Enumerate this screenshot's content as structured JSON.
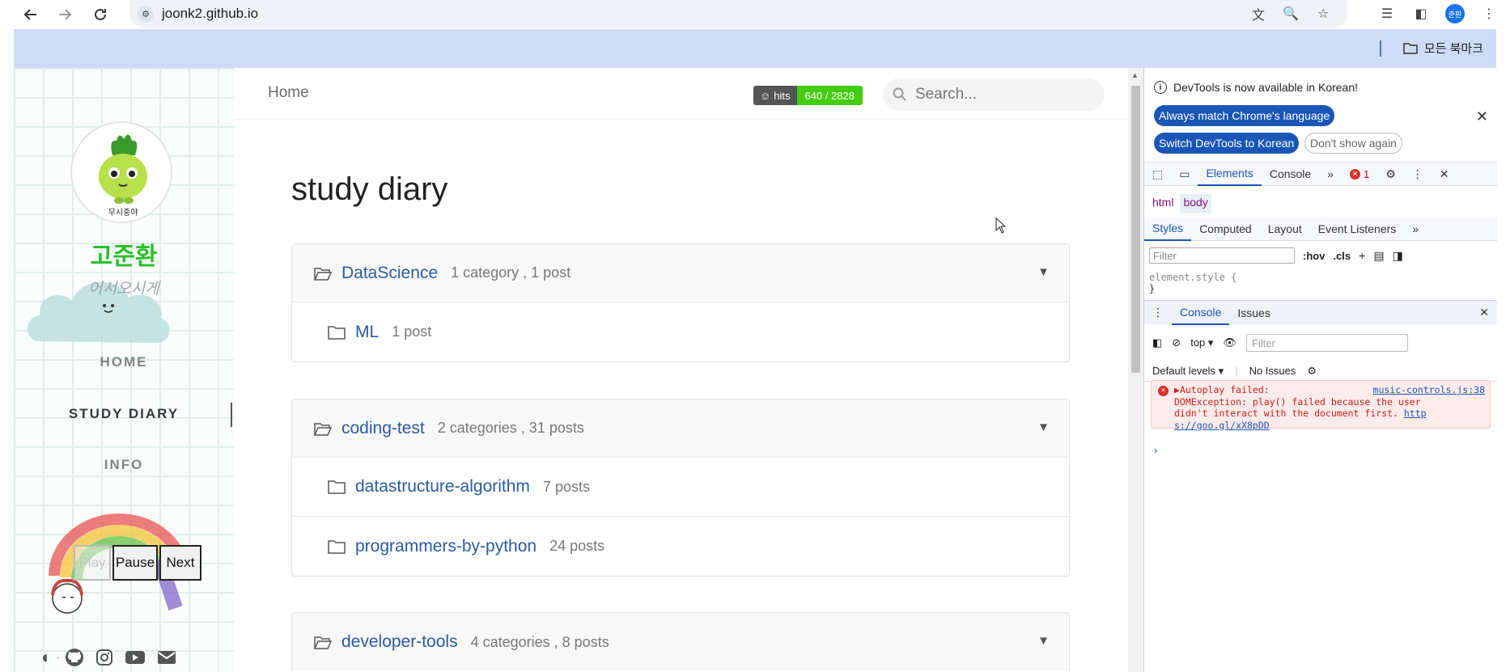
{
  "browser": {
    "url": "joonk2.github.io",
    "profile_initials": "준환",
    "bookmarks_all": "모든 북마크"
  },
  "sidebar": {
    "avatar_caption": "무시중야",
    "title": "고준환",
    "subtitle": "어서오시게",
    "nav": [
      {
        "label": "HOME"
      },
      {
        "label": "STUDY DIARY"
      },
      {
        "label": "INFO"
      }
    ],
    "music": {
      "play": "Play",
      "pause": "Pause",
      "next": "Next"
    },
    "accent_color": "#2bc02b"
  },
  "main": {
    "breadcrumb": "Home",
    "hits": {
      "label": "hits",
      "value": "640 / 2828"
    },
    "search_placeholder": "Search...",
    "page_title": "study diary",
    "categories": [
      {
        "name": "DataScience",
        "meta": "1 category , 1 post",
        "children": [
          {
            "name": "ML",
            "meta": "1 post"
          }
        ]
      },
      {
        "name": "coding-test",
        "meta": "2 categories , 31 posts",
        "children": [
          {
            "name": "datastructure-algorithm",
            "meta": "7 posts"
          },
          {
            "name": "programmers-by-python",
            "meta": "24 posts"
          }
        ]
      },
      {
        "name": "developer-tools",
        "meta": "4 categories , 8 posts",
        "children": []
      }
    ],
    "link_color": "#2a5ba0"
  },
  "devtools": {
    "notice": "DevTools is now available in Korean!",
    "btn_match": "Always match Chrome's language",
    "btn_switch": "Switch DevTools to Korean",
    "btn_dont_show": "Don't show again",
    "tabs": {
      "elements": "Elements",
      "console": "Console",
      "error_count": "1"
    },
    "crumb_html": "html",
    "crumb_body": "body",
    "style_tabs": {
      "styles": "Styles",
      "computed": "Computed",
      "layout": "Layout",
      "listeners": "Event Listeners"
    },
    "filter_placeholder": "Filter",
    "hov": ":hov",
    "cls": ".cls",
    "element_style": "element.style {",
    "close_brace": "}",
    "drawer_tabs": {
      "console": "Console",
      "issues": "Issues"
    },
    "context": "top",
    "console_filter": "Filter",
    "default_levels": "Default levels",
    "no_issues": "No Issues",
    "error": {
      "title": "Autoplay failed:",
      "source": "music-controls.js:38",
      "line2": "DOMException: play() failed because the user",
      "line3": "didn't interact with the document first.",
      "link1": "http",
      "link2": "s://goo.gl/xX8pDD"
    }
  }
}
